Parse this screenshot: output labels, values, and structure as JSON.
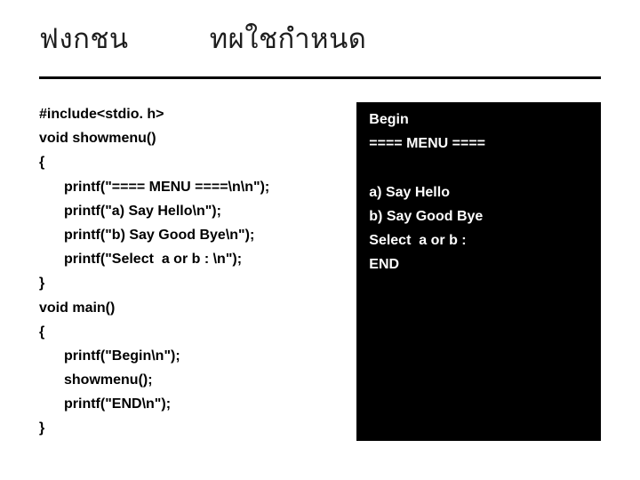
{
  "title": "ฟงกชน          ทผใชกำหนด",
  "code": {
    "l1": "#include<stdio. h>",
    "l2": "void showmenu()",
    "l3": "{",
    "l4": "printf(\"==== MENU ====\\n\\n\");",
    "l5": "printf(\"a) Say Hello\\n\");",
    "l6": "printf(\"b) Say Good Bye\\n\");",
    "l7": "printf(\"Select  a or b : \\n\");",
    "l8": "}",
    "l9": "void main()",
    "l10": "{",
    "l11": "printf(\"Begin\\n\");",
    "l12": "showmenu();",
    "l13": "printf(\"END\\n\");",
    "l14": "}"
  },
  "output": {
    "o1": "Begin",
    "o2": "==== MENU ====",
    "o3": "a) Say Hello",
    "o4": "b) Say Good Bye",
    "o5": "Select  a or b :",
    "o6": "END"
  }
}
